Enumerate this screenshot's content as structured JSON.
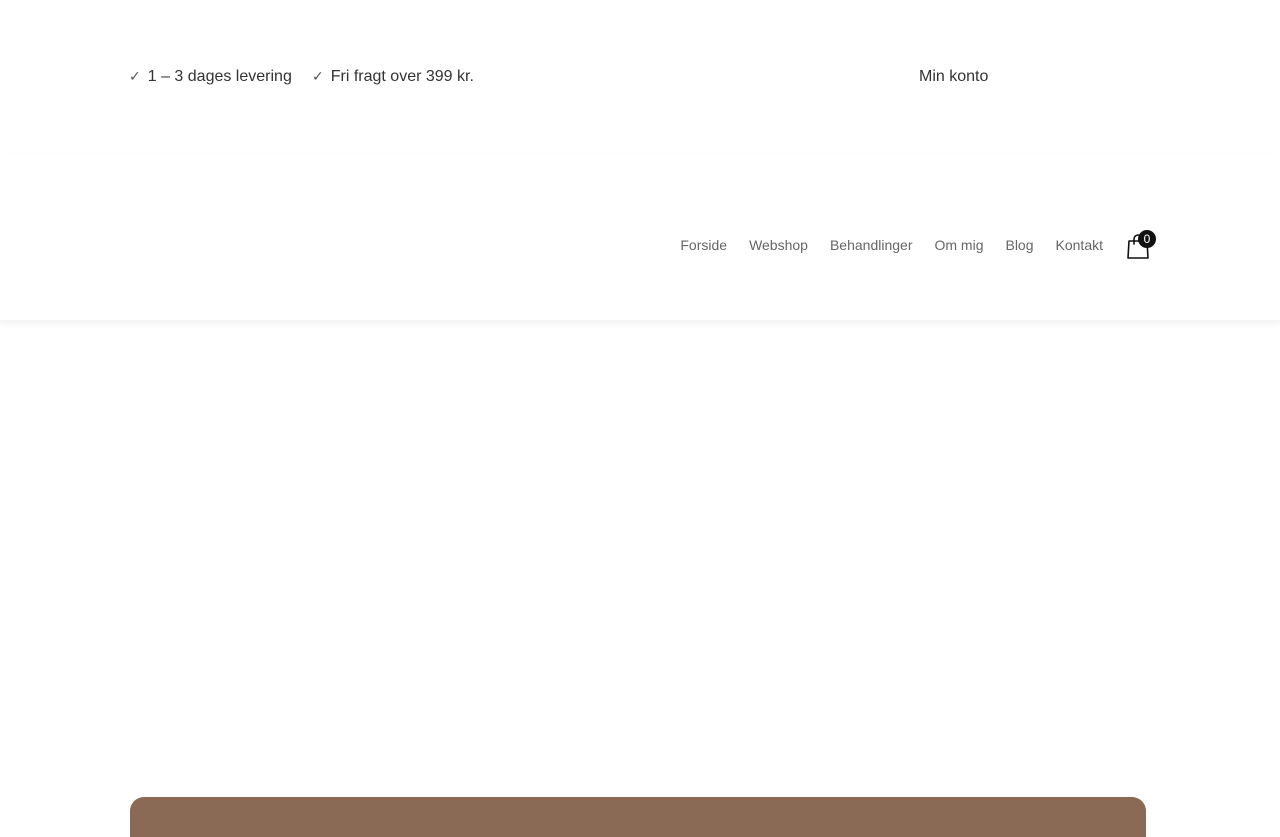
{
  "topbar": {
    "usps": [
      {
        "icon": "check-icon",
        "text": "1 – 3 dages levering"
      },
      {
        "icon": "check-icon",
        "text": "Fri fragt over 399 kr."
      }
    ],
    "account_label": "Min konto"
  },
  "nav": {
    "items": [
      {
        "label": "Forside"
      },
      {
        "label": "Webshop"
      },
      {
        "label": "Behandlinger"
      },
      {
        "label": "Om mig"
      },
      {
        "label": "Blog"
      },
      {
        "label": "Kontakt"
      }
    ]
  },
  "cart": {
    "icon": "shopping-bag-icon",
    "count": "0"
  },
  "colors": {
    "text": "#333333",
    "nav_text": "#666666",
    "badge_bg": "#111111",
    "accent_brown": "#8a6a55"
  }
}
